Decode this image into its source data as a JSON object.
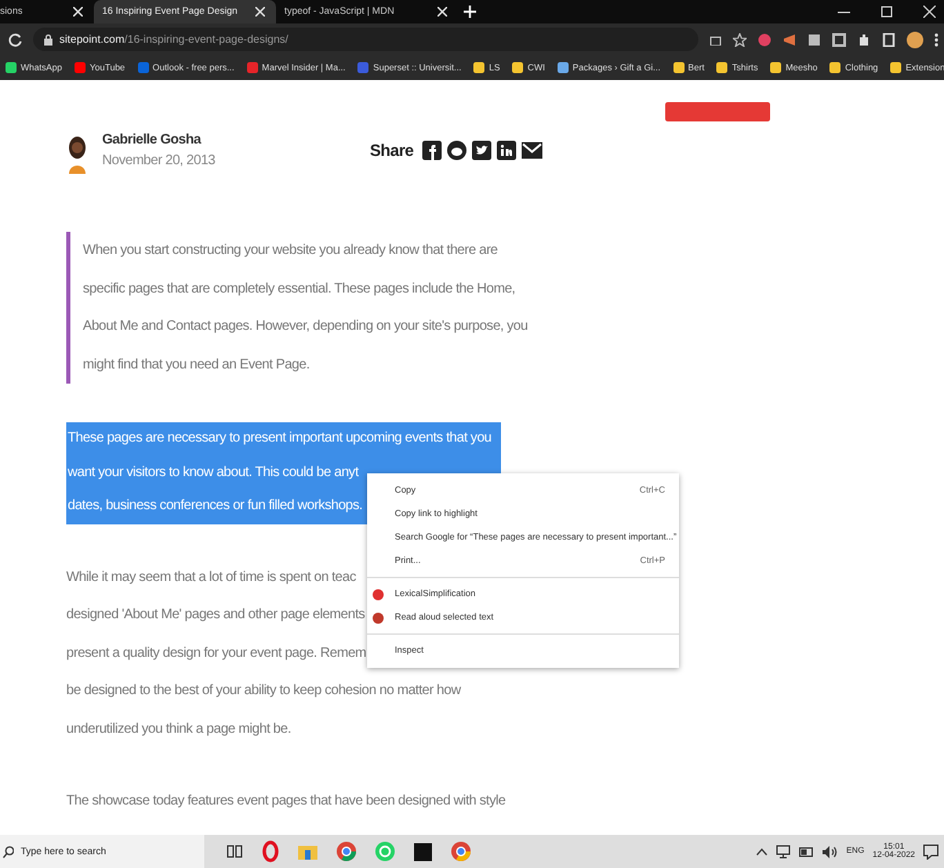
{
  "tabs": [
    {
      "title": "sions",
      "selected": false
    },
    {
      "title": "16 Inspiring Event Page Design",
      "selected": true
    },
    {
      "title": "typeof - JavaScript | MDN",
      "selected": false
    }
  ],
  "address": {
    "host": "sitepoint.com",
    "path": "/16-inspiring-event-page-designs/"
  },
  "bookmarks": [
    {
      "label": "WhatsApp",
      "color": "#25d366"
    },
    {
      "label": "YouTube",
      "color": "#ff0000"
    },
    {
      "label": "Outlook - free pers...",
      "color": "#0a64d8"
    },
    {
      "label": "Marvel Insider | Ma...",
      "color": "#e62429"
    },
    {
      "label": "Superset :: Universit...",
      "color": "#3b5bdb"
    },
    {
      "label": "LS",
      "color": "#f4c430"
    },
    {
      "label": "CWI",
      "color": "#f4c430"
    },
    {
      "label": "Packages › Gift a Gi...",
      "color": "#6aa9e9"
    },
    {
      "label": "Bert",
      "color": "#f4c430"
    },
    {
      "label": "Tshirts",
      "color": "#f4c430"
    },
    {
      "label": "Meesho",
      "color": "#f4c430"
    },
    {
      "label": "Clothing",
      "color": "#f4c430"
    },
    {
      "label": "Extension",
      "color": "#f4c430"
    }
  ],
  "author": {
    "name": "Gabrielle Gosha",
    "date": "November 20, 2013"
  },
  "share": {
    "label": "Share"
  },
  "quote": [
    "When you start constructing your website you already know that there are",
    "specific pages that are completely essential. These pages include the Home,",
    "About Me and Contact pages. However, depending on your site's purpose, you",
    "might find that you need an Event Page."
  ],
  "selected_paragraph": [
    "These pages are necessary to present important upcoming events that you",
    "want your visitors to know about. This could be anyt",
    "dates, business conferences or fun filled workshops."
  ],
  "paragraph": [
    "While it may seem that a lot of time is spent on teac",
    "designed 'About Me' pages and other page elements",
    "present a quality design for your event page. Remem",
    "be designed to the best of your ability to keep cohesion no matter how",
    "underutilized you think a page might be."
  ],
  "last_paragraph": [
    "The showcase today features event pages that have been designed with style"
  ],
  "context_menu": [
    {
      "kind": "item",
      "label": "Copy",
      "shortcut": "Ctrl+C"
    },
    {
      "kind": "item",
      "label": "Copy link to highlight"
    },
    {
      "kind": "item",
      "label": "Search Google for “These pages are necessary to present important...”"
    },
    {
      "kind": "item",
      "label": "Print...",
      "shortcut": "Ctrl+P"
    },
    {
      "kind": "separator"
    },
    {
      "kind": "extension",
      "label": "LexicalSimplification",
      "color": "#e03030"
    },
    {
      "kind": "extension",
      "label": "Read aloud selected text",
      "color": "#c0392b"
    },
    {
      "kind": "separator"
    },
    {
      "kind": "item",
      "label": "Inspect"
    }
  ],
  "taskbar": {
    "search_placeholder": "Type here to search",
    "language": "ENG",
    "time": "15:01",
    "date": "12-04-2022"
  }
}
